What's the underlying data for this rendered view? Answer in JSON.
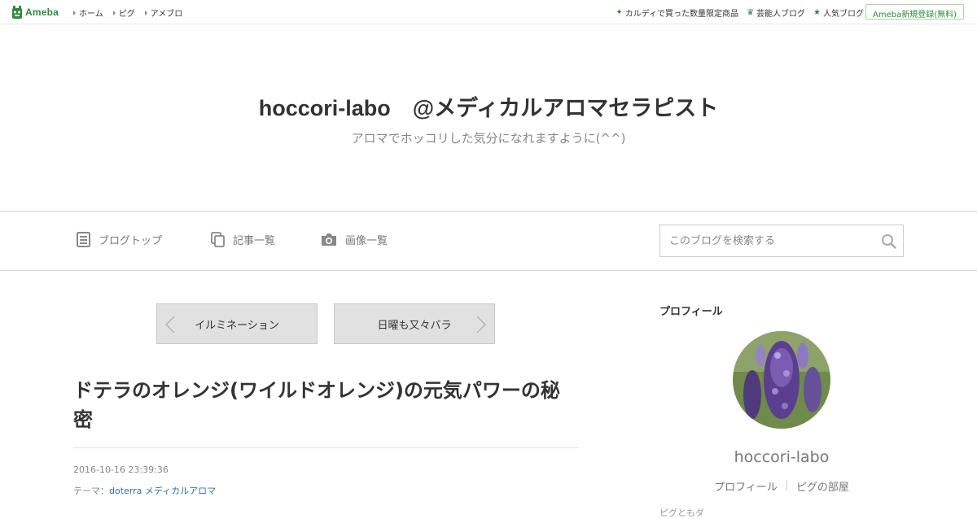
{
  "global_header": {
    "logo_text": "Ameba",
    "nav": [
      "ホーム",
      "ピグ",
      "アメブロ"
    ],
    "right_links": [
      {
        "icon": "sparkle-icon",
        "label": "カルディで買った数量限定商品"
      },
      {
        "icon": "crown-icon",
        "label": "芸能人ブログ"
      },
      {
        "icon": "star-icon",
        "label": "人気ブログ"
      }
    ],
    "register_label": "Ameba新規登録(無料)"
  },
  "blog_header": {
    "title": "hoccori-labo　@メディカルアロマセラピスト",
    "description": "アロマでホッコリした気分になれますように(^^)"
  },
  "blog_nav": {
    "items": [
      {
        "icon": "document-icon",
        "label": "ブログトップ"
      },
      {
        "icon": "copy-icon",
        "label": "記事一覧"
      },
      {
        "icon": "camera-icon",
        "label": "画像一覧"
      }
    ],
    "search_placeholder": "このブログを検索する"
  },
  "pager": {
    "prev_label": "イルミネーション",
    "next_label": "日曜も又々バラ"
  },
  "entry": {
    "title": "ドテラのオレンジ(ワイルドオレンジ)の元気パワーの秘密",
    "date": "2016-10-16 23:39:36",
    "theme_prefix": "テーマ：",
    "theme_link": "doterra メディカルアロマ"
  },
  "sidebar": {
    "heading": "プロフィール",
    "name": "hoccori-labo",
    "links": [
      "プロフィール",
      "ピグの部屋"
    ],
    "cut_text": "ピグともダ"
  },
  "colors": {
    "brand_green": "#2d8c3c",
    "link_blue": "#3371b3"
  }
}
